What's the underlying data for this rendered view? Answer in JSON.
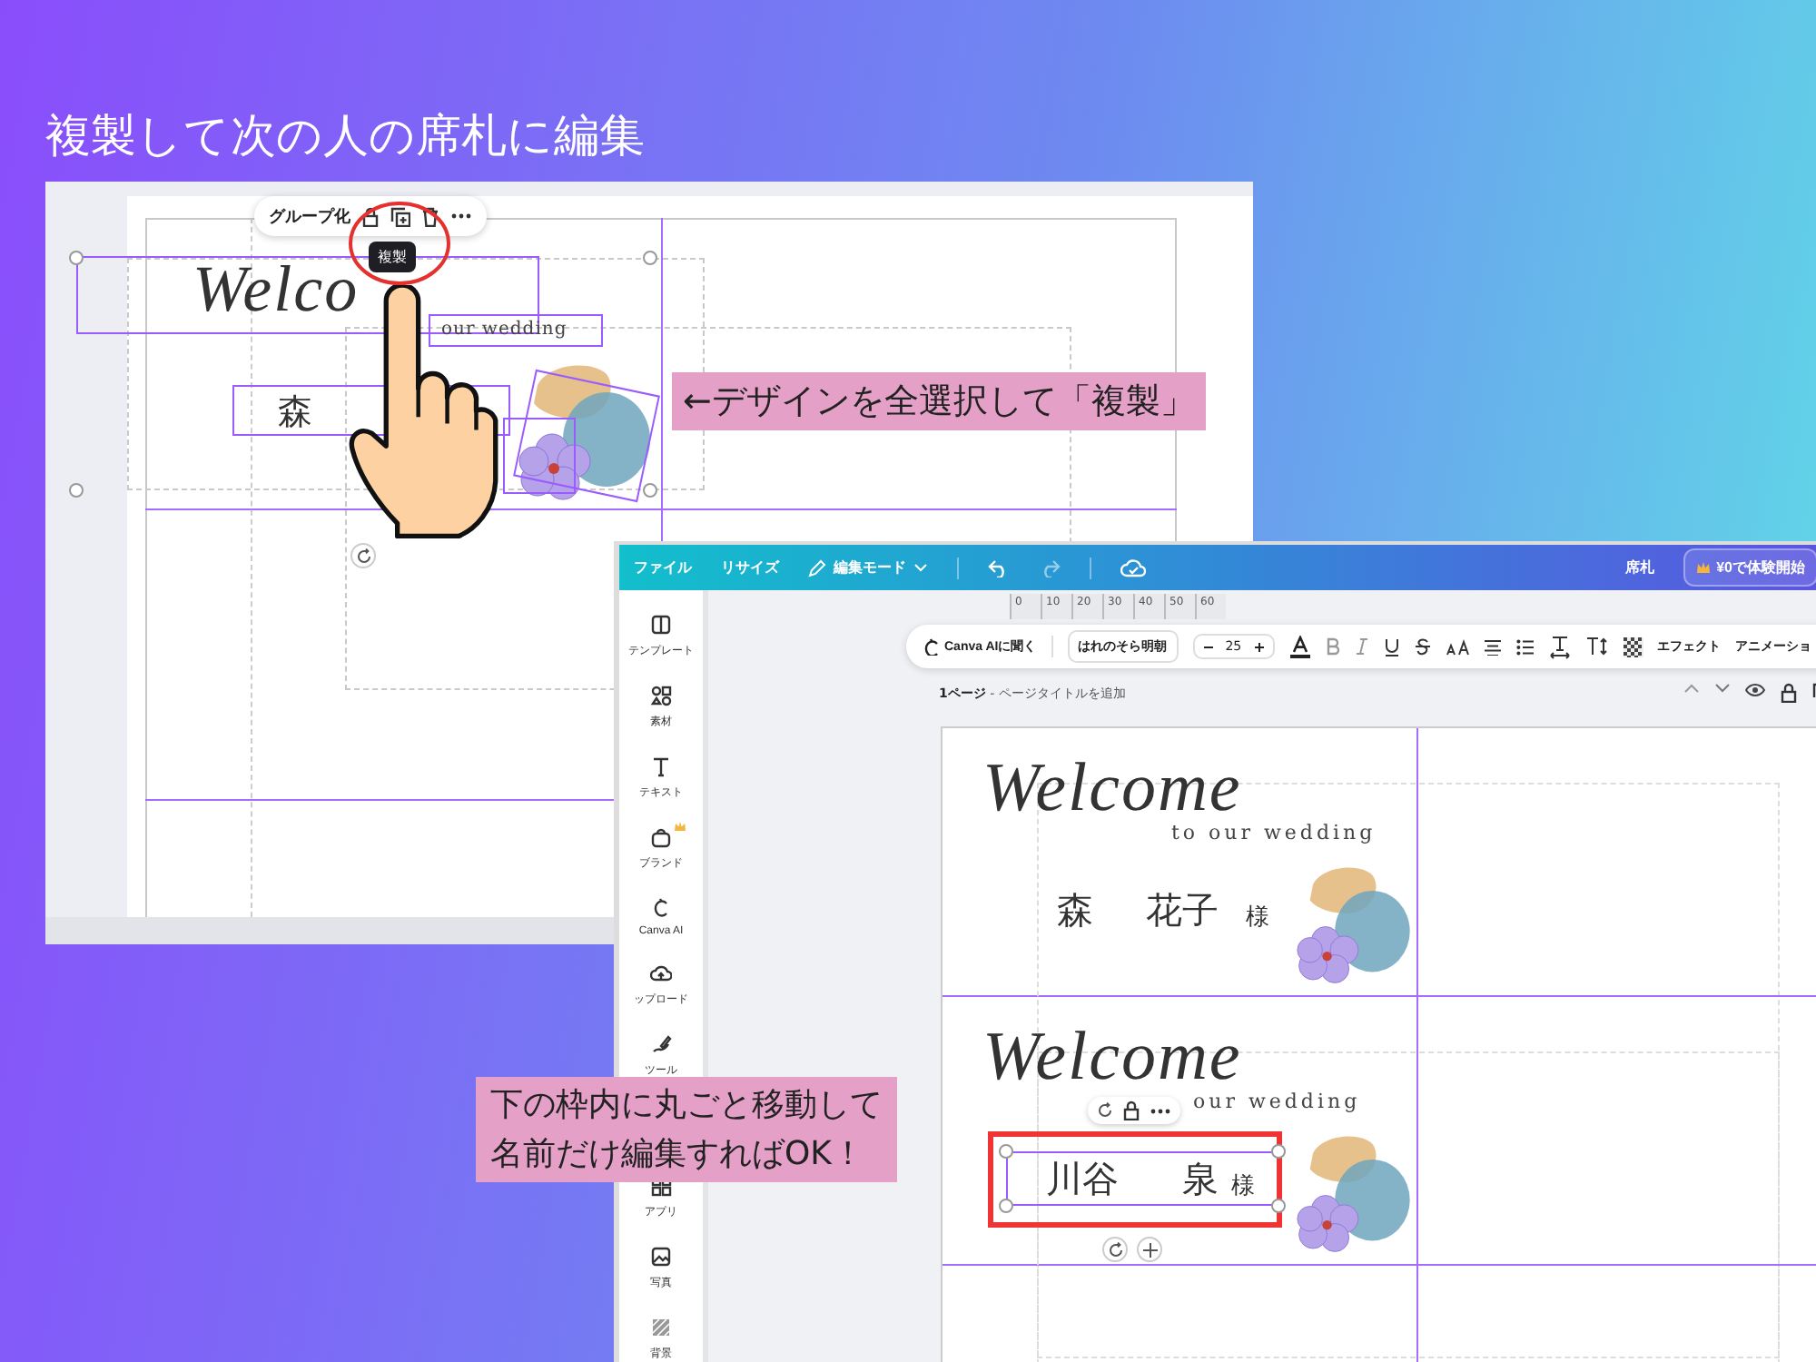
{
  "heading": "複製して次の人の席札に編集",
  "editor_back": {
    "toolbar_label": "グループ化",
    "tooltip": "複製",
    "card": {
      "script": "Welco",
      "subtitle": "our wedding",
      "surname": "森"
    }
  },
  "callout_top": "←デザインを全選択して「複製」",
  "editor_front": {
    "menu": [
      {
        "label": "ファイル",
        "kind": "text"
      },
      {
        "label": "リサイズ",
        "kind": "text"
      },
      {
        "label": "編集モード",
        "kind": "mode"
      }
    ],
    "doc_title": "席札",
    "trial_button": "¥0で体験開始",
    "sidebar": [
      {
        "label": "テンプレート",
        "kind": "template"
      },
      {
        "label": "素材",
        "kind": "elements"
      },
      {
        "label": "テキスト",
        "kind": "text"
      },
      {
        "label": "ブランド",
        "kind": "brand"
      },
      {
        "label": "Canva AI",
        "kind": "ai"
      },
      {
        "label": "ップロード",
        "kind": "upload"
      },
      {
        "label": "ツール",
        "kind": "tool"
      },
      {
        "label": "アプリ",
        "kind": "apps"
      },
      {
        "label": "写真",
        "kind": "photo"
      },
      {
        "label": "背景",
        "kind": "background"
      }
    ],
    "ruler": [
      "0",
      "10",
      "20",
      "30",
      "40",
      "50",
      "60"
    ],
    "text_toolbar": {
      "ai_button": "Canva AIに聞く",
      "font": "はれのそら明朝",
      "size": "25",
      "effects": "エフェクト",
      "animation": "アニメーショ"
    },
    "page_header": {
      "title": "**1ページ** - ページタイトルを追加"
    },
    "cards": [
      {
        "script": "Welcome",
        "subtitle": "to our wedding",
        "surname": "森",
        "given": "花子",
        "honorific": "様",
        "selected": false
      },
      {
        "script": "Welcome",
        "subtitle": "our wedding",
        "surname": "川谷",
        "given": "泉",
        "honorific": "様",
        "selected": true
      }
    ]
  },
  "callout_bottom": [
    "下の枠内に丸ごと移動して",
    "名前だけ編集すればOK！"
  ]
}
